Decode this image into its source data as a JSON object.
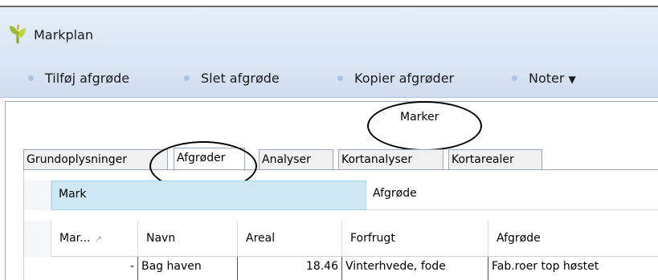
{
  "window": {
    "title": "Markplan"
  },
  "toolbar": {
    "add_crop": "Tilføj afgrøde",
    "delete_crop": "Slet afgrøde",
    "copy_crops": "Kopier afgrøder",
    "notes": "Noter"
  },
  "section": {
    "heading": "Marker"
  },
  "tabs": [
    {
      "label": "Grundoplysninger"
    },
    {
      "label": "Afgrøder"
    },
    {
      "label": "Analyser"
    },
    {
      "label": "Kortanalyser"
    },
    {
      "label": "Kortarealer"
    }
  ],
  "grid": {
    "bands": [
      {
        "label": "Mark"
      },
      {
        "label": "Afgrøde"
      }
    ],
    "columns": [
      {
        "label": "Mar..."
      },
      {
        "label": "Navn"
      },
      {
        "label": "Areal"
      },
      {
        "label": "Forfrugt"
      },
      {
        "label": "Afgrøde"
      }
    ],
    "rows": [
      {
        "mark": "-",
        "navn": "Bag haven",
        "areal": "18.46",
        "forfrugt": "Vinterhvede, fode",
        "afgrode": "Fab.roer top høstet"
      }
    ]
  },
  "colors": {
    "accent": "#cfe8f6",
    "toolbar": "#d9e5f5"
  }
}
